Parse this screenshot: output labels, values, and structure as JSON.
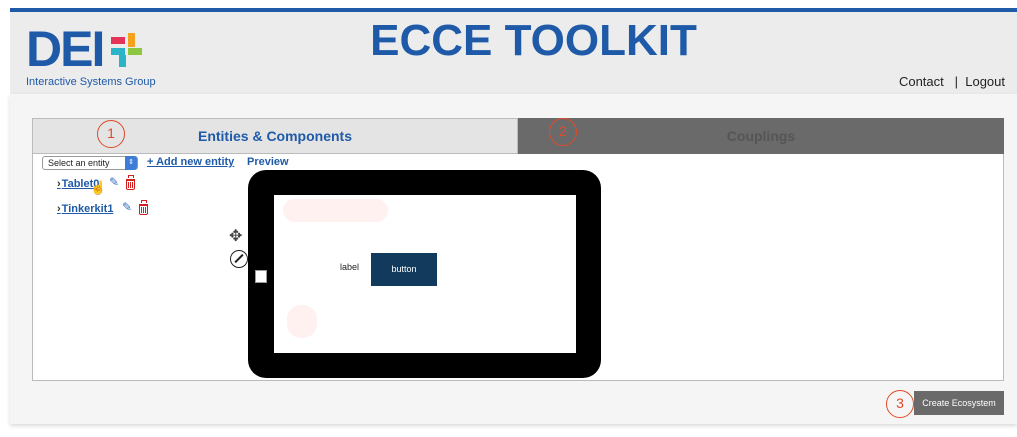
{
  "header": {
    "logo_text": "DEI",
    "logo_subtitle": "Interactive Systems Group",
    "title": "ECCE TOOLKIT",
    "links": {
      "contact": "Contact",
      "separator": "|",
      "logout": "Logout"
    }
  },
  "tabs": [
    {
      "label": "Entities & Components",
      "step": "1",
      "active": true
    },
    {
      "label": "Couplings",
      "step": "2",
      "active": false
    }
  ],
  "toolbar": {
    "select_value": "Select an entity",
    "add_label": "+ Add new entity",
    "preview_label": "Preview"
  },
  "entities": [
    {
      "name": "Tablet0"
    },
    {
      "name": "Tinkerkit1"
    }
  ],
  "preview": {
    "label_text": "label",
    "button_text": "button"
  },
  "footer": {
    "step": "3",
    "create_label": "Create Ecosystem"
  },
  "colors": {
    "brand": "#1e5aa8",
    "annotation": "#e04a2a",
    "preview_button": "#123a5c",
    "inactive_tab": "#6a6a6a"
  }
}
